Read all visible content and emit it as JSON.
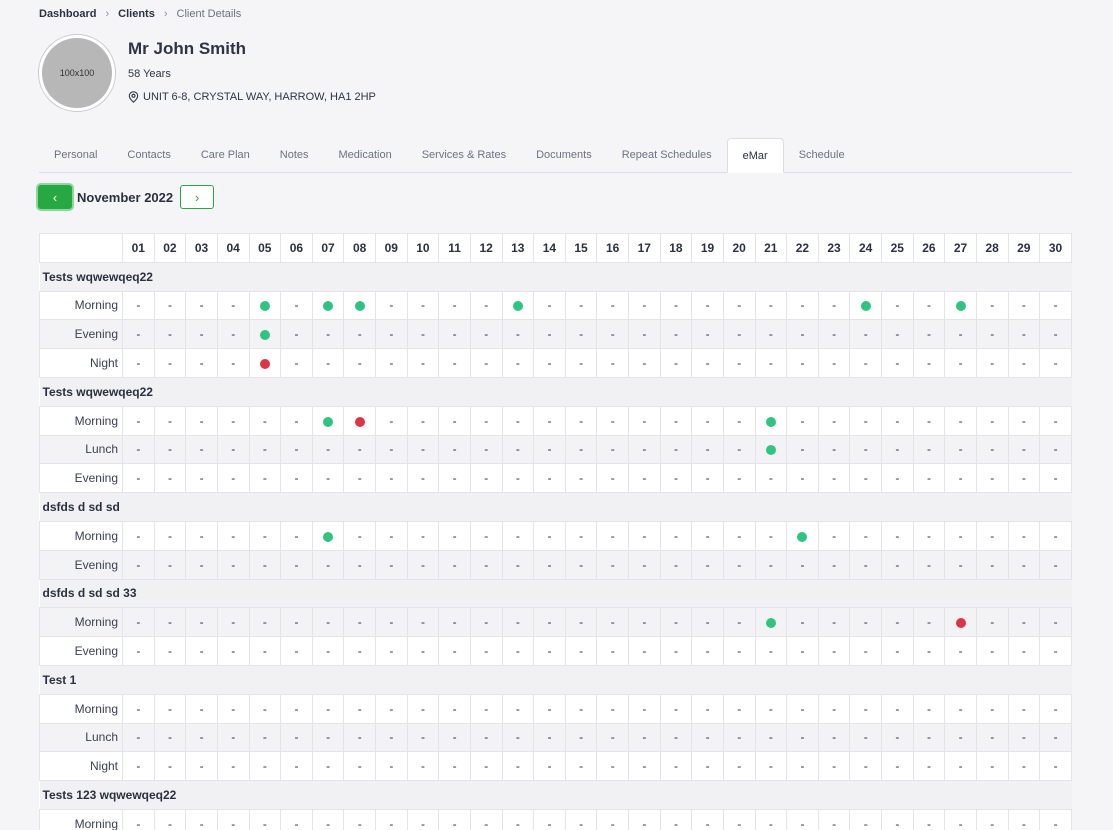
{
  "breadcrumb": [
    "Dashboard",
    "Clients",
    "Client Details"
  ],
  "client": {
    "avatar_text": "100x100",
    "name": "Mr John Smith",
    "age": "58 Years",
    "address": "UNIT 6-8, CRYSTAL WAY, HARROW, HA1 2HP"
  },
  "tabs": [
    "Personal",
    "Contacts",
    "Care Plan",
    "Notes",
    "Medication",
    "Services & Rates",
    "Documents",
    "Repeat Schedules",
    "eMar",
    "Schedule"
  ],
  "active_tab": "eMar",
  "month_nav": {
    "prev": "‹",
    "label": "November 2022",
    "next": "›"
  },
  "empty_mark": "-",
  "status_colors": {
    "given": "#2fc47f",
    "missed": "#dc3545"
  },
  "days": [
    "01",
    "02",
    "03",
    "04",
    "05",
    "06",
    "07",
    "08",
    "09",
    "10",
    "11",
    "12",
    "13",
    "14",
    "15",
    "16",
    "17",
    "18",
    "19",
    "20",
    "21",
    "22",
    "23",
    "24",
    "25",
    "26",
    "27",
    "28",
    "29",
    "30"
  ],
  "groups": [
    {
      "name": "Tests wqwewqeq22",
      "rows": [
        {
          "slot": "Morning",
          "given": [
            "05",
            "07",
            "08",
            "13",
            "24",
            "27"
          ],
          "missed": []
        },
        {
          "slot": "Evening",
          "given": [
            "05"
          ],
          "missed": []
        },
        {
          "slot": "Night",
          "given": [],
          "missed": [
            "05"
          ]
        }
      ]
    },
    {
      "name": "Tests wqwewqeq22",
      "rows": [
        {
          "slot": "Morning",
          "given": [
            "07",
            "21"
          ],
          "missed": [
            "08"
          ]
        },
        {
          "slot": "Lunch",
          "given": [
            "21"
          ],
          "missed": []
        },
        {
          "slot": "Evening",
          "given": [],
          "missed": []
        }
      ]
    },
    {
      "name": "dsfds d sd sd",
      "rows": [
        {
          "slot": "Morning",
          "given": [
            "07",
            "22"
          ],
          "missed": []
        },
        {
          "slot": "Evening",
          "given": [],
          "missed": []
        }
      ]
    },
    {
      "name": "dsfds d sd sd 33",
      "rows": [
        {
          "slot": "Morning",
          "given": [
            "21"
          ],
          "missed": [
            "27"
          ]
        },
        {
          "slot": "Evening",
          "given": [],
          "missed": []
        }
      ]
    },
    {
      "name": "Test 1",
      "rows": [
        {
          "slot": "Morning",
          "given": [],
          "missed": []
        },
        {
          "slot": "Lunch",
          "given": [],
          "missed": []
        },
        {
          "slot": "Night",
          "given": [],
          "missed": []
        }
      ]
    },
    {
      "name": "Tests 123 wqwewqeq22",
      "rows": [
        {
          "slot": "Morning",
          "given": [],
          "missed": []
        }
      ]
    }
  ]
}
